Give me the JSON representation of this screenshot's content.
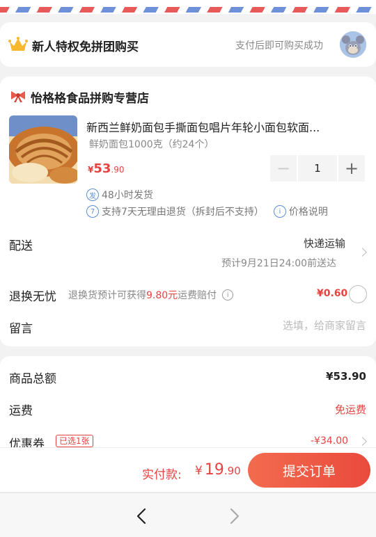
{
  "promo": {
    "title": "新人特权免拼团购买",
    "note": "支付后即可购买成功"
  },
  "shop": {
    "name": "怡格格食品拼购专营店"
  },
  "product": {
    "name": "新西兰鲜奶面包手撕面包唱片年轮小面包软面...",
    "spec": "鲜奶面包1000克（约24个）",
    "price_symbol": "¥",
    "price_int": "53",
    "price_dec": ".90",
    "quantity": "1",
    "minus": "−",
    "plus": "+"
  },
  "badges": {
    "ship_icon": "发",
    "ship_text": "48小时发货",
    "return_icon": "7",
    "return_text": "支持7天无理由退货（拆封后不支持）",
    "price_info_icon": "i",
    "price_info_text": "价格说明"
  },
  "delivery": {
    "label": "配送",
    "method": "快递运输",
    "eta": "预计9月21日24:00前送达"
  },
  "worry_free": {
    "label": "退换无忧",
    "desc_prefix": "退换货预计可获得",
    "desc_amount": "9.80元",
    "desc_suffix": "运费赔付",
    "info_icon": "i",
    "price": "¥0.60"
  },
  "message": {
    "label": "留言",
    "placeholder": "选填，给商家留言"
  },
  "summary": {
    "total_label": "商品总额",
    "total_value": "¥53.90",
    "freight_label": "运费",
    "freight_value": "免运费",
    "coupon_label": "优惠券",
    "coupon_tag": "已选1张",
    "coupon_value": "-¥34.00"
  },
  "checkout": {
    "pay_label": "实付款:",
    "pay_symbol": "¥",
    "pay_int": "19",
    "pay_dec": ".90",
    "submit_label": "提交订单"
  },
  "colors": {
    "accent": "#e64340",
    "button_start": "#f26b4f",
    "button_end": "#ea4a3c",
    "badge_blue": "#5b8fd6"
  },
  "icons": [
    "crown-icon",
    "bow-icon",
    "chevron-right-icon",
    "info-icon",
    "back-arrow-icon",
    "forward-arrow-icon"
  ]
}
